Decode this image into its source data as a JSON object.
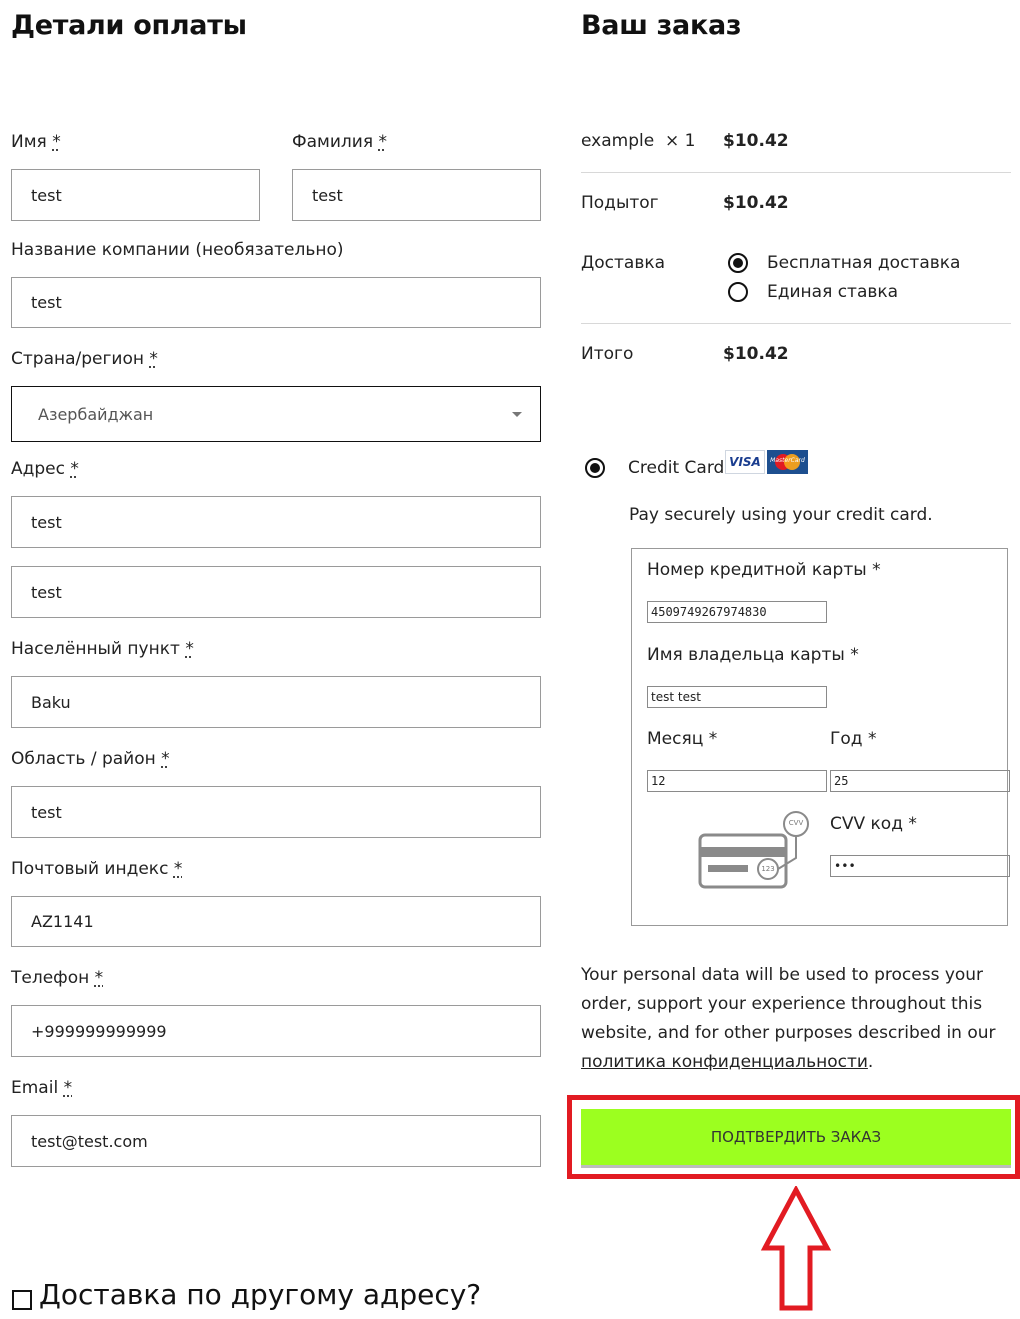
{
  "billing": {
    "title": "Детали оплаты",
    "first_name": {
      "label": "Имя",
      "value": "test"
    },
    "last_name": {
      "label": "Фамилия",
      "value": "test"
    },
    "company": {
      "label": "Название компании (необязательно)",
      "value": "test"
    },
    "country": {
      "label": "Страна/регион",
      "value": "Азербайджан"
    },
    "address": {
      "label": "Адрес",
      "value1": "test",
      "value2": "test"
    },
    "city": {
      "label": "Населённый пункт",
      "value": "Baku"
    },
    "state": {
      "label": "Область / район",
      "value": "test"
    },
    "postcode": {
      "label": "Почтовый индекс",
      "value": "AZ1141"
    },
    "phone": {
      "label": "Телефон",
      "value": "+999999999999"
    },
    "email": {
      "label": "Email",
      "value": "test@test.com"
    },
    "required_mark": "*"
  },
  "order": {
    "title": "Ваш заказ",
    "item_name": "example",
    "item_qty": "× 1",
    "item_price": "$10.42",
    "subtotal_label": "Подытог",
    "subtotal_value": "$10.42",
    "shipping_label": "Доставка",
    "shipping_options": [
      "Бесплатная доставка",
      "Единая ставка"
    ],
    "shipping_selected": 0,
    "total_label": "Итого",
    "total_value": "$10.42"
  },
  "payment": {
    "method_label": "Credit Card",
    "visa_text": "VISA",
    "mastercard_text": "MasterCard",
    "description": "Pay securely using your credit card.",
    "card_number": {
      "label": "Номер кредитной карты",
      "value": "4509749267974830"
    },
    "card_holder": {
      "label": "Имя владельца карты",
      "value": "test test"
    },
    "month": {
      "label": "Месяц",
      "value": "12"
    },
    "year": {
      "label": "Год",
      "value": "25"
    },
    "cvv": {
      "label": "CVV код",
      "value": "•••"
    },
    "cvv_icon_top": "CVV",
    "cvv_icon_bottom": "123"
  },
  "privacy": {
    "text": "Your personal data will be used to process your order, support your throughout this website, and for other purposes described in our",
    "line1": "Your personal data will be used to process your",
    "line2": "order, support your experience throughout this",
    "line3": "website, and for other purposes described in our",
    "link": "политика конфиденциальности",
    "end": "."
  },
  "submit": {
    "label": "ПОДТВЕРДИТЬ ЗАКАЗ"
  },
  "ship_other": {
    "label": "Доставка по другому адресу?"
  },
  "colors": {
    "button": "#9cff1f",
    "highlight": "#e21b22"
  }
}
